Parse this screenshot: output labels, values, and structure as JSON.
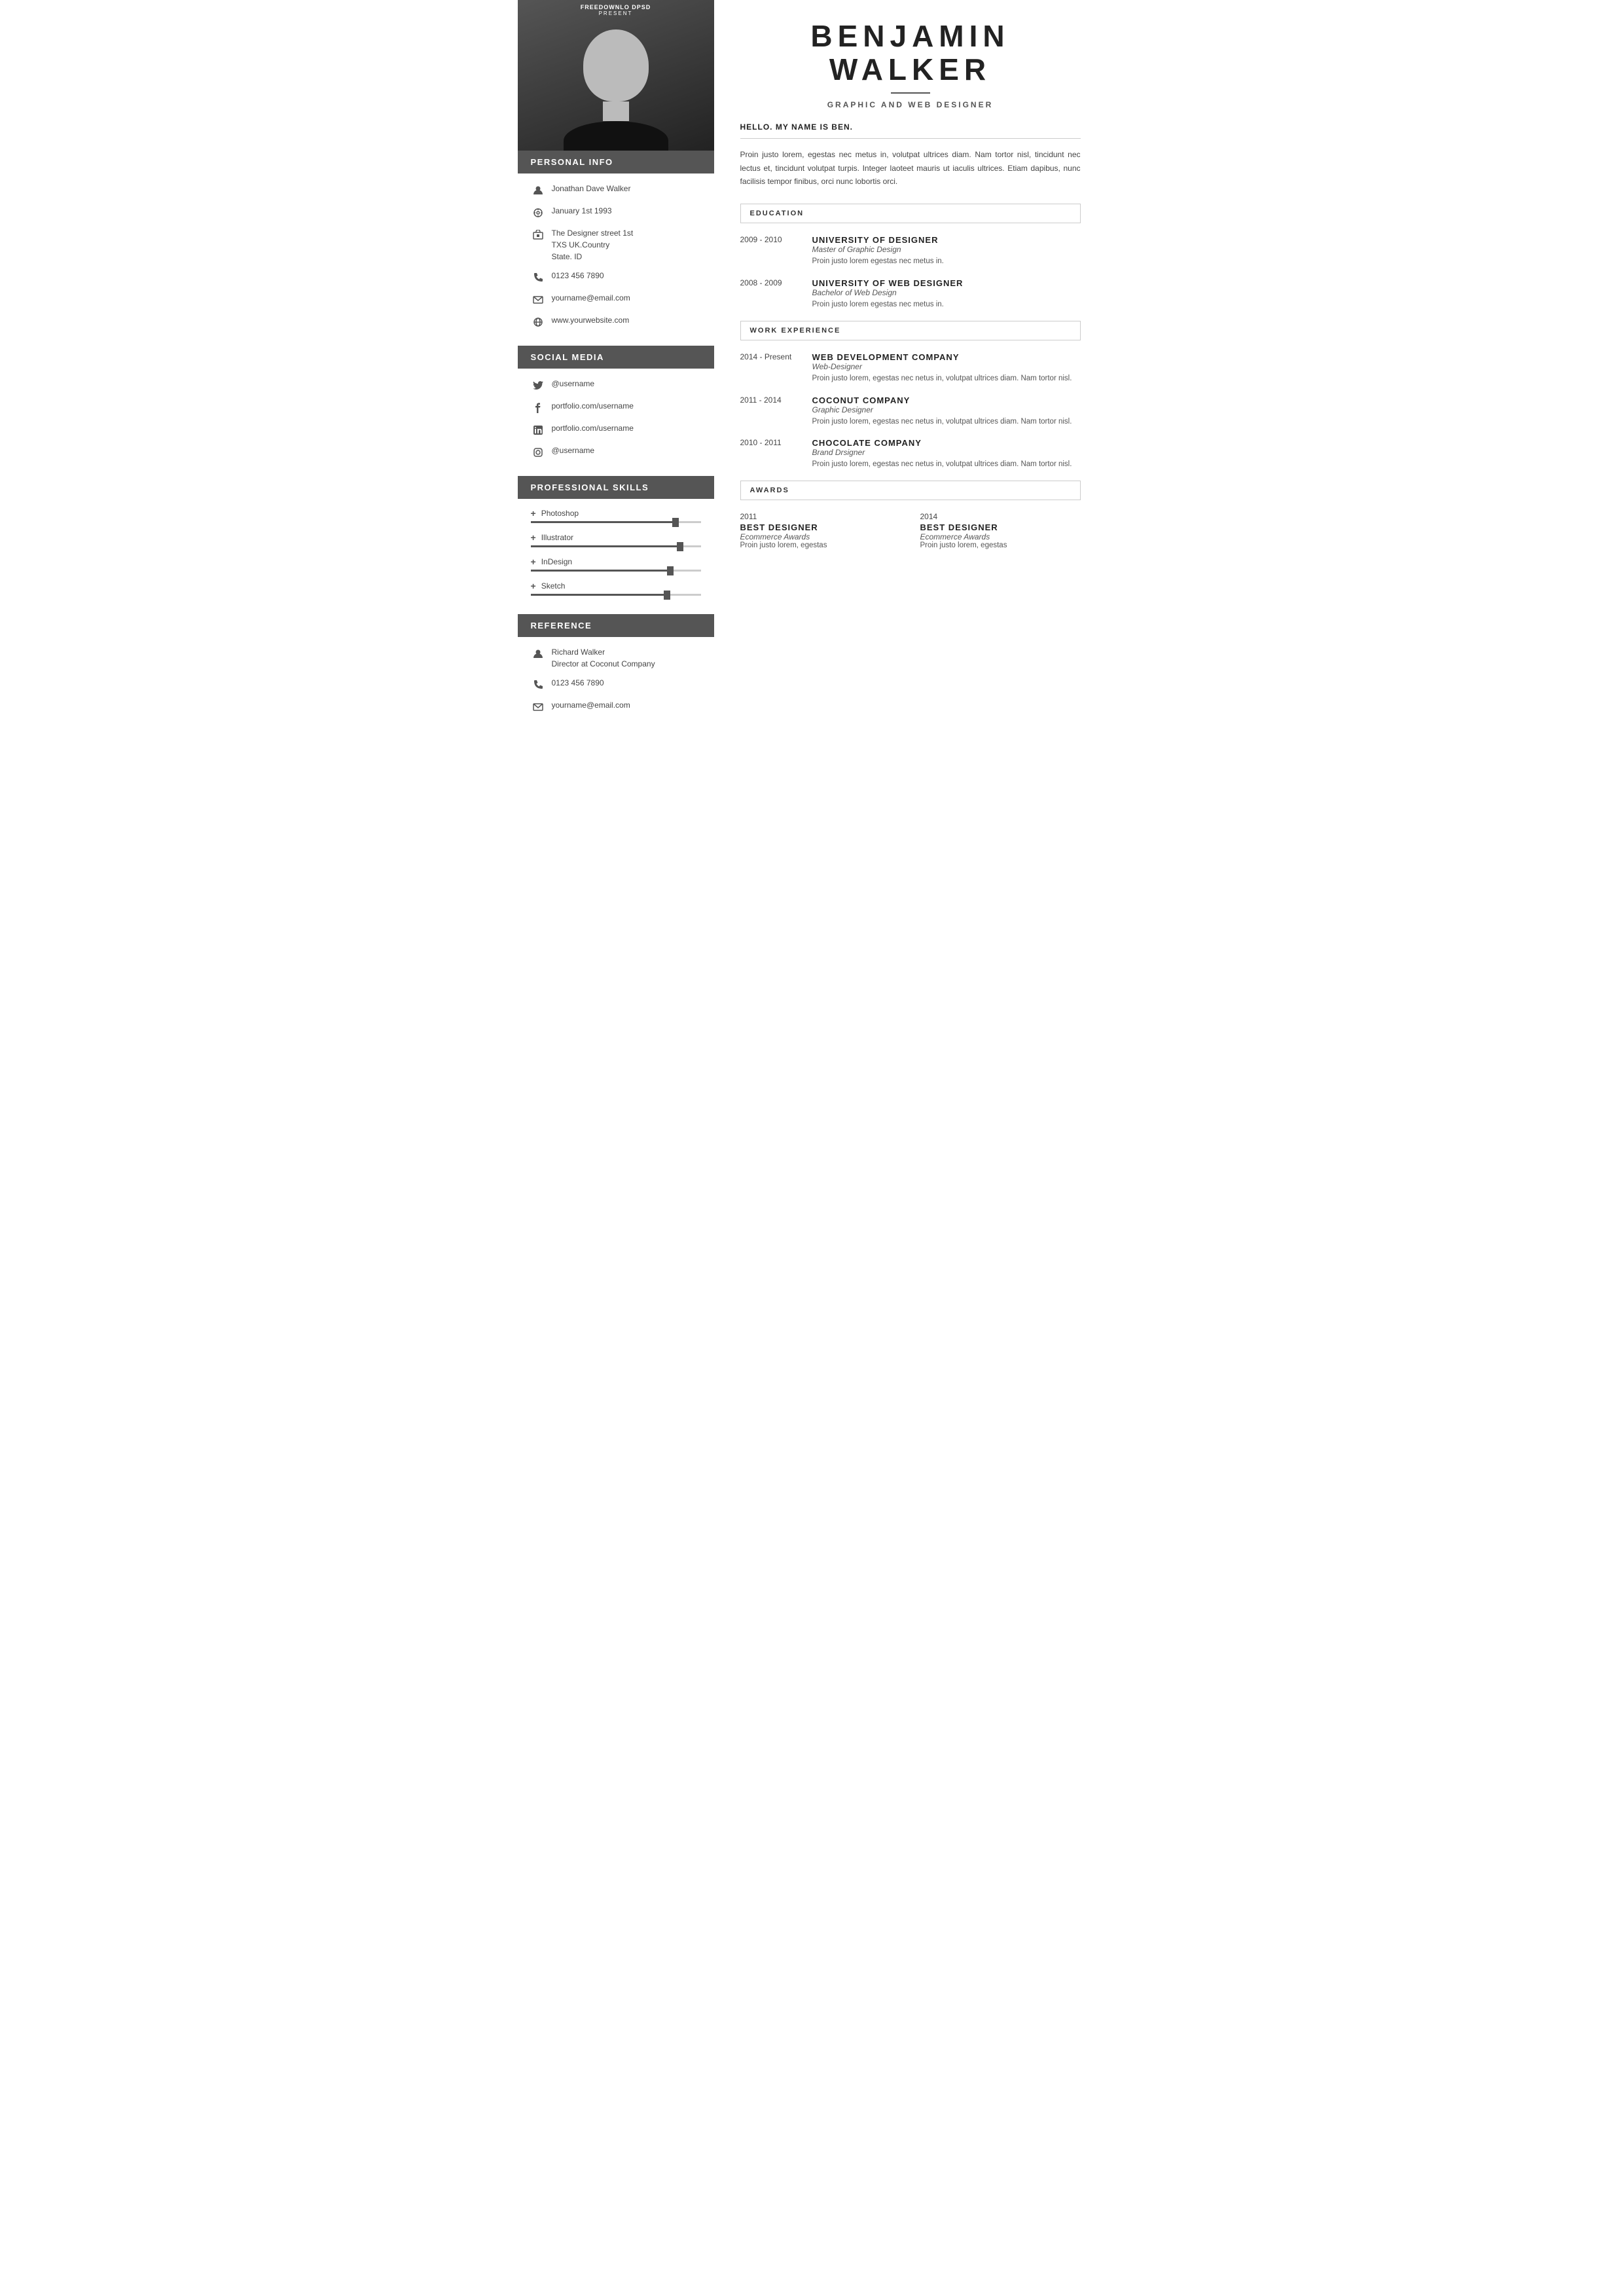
{
  "watermark": {
    "brand": "FREEDOWNLO DPSD",
    "sub": "PRESENT"
  },
  "sidebar": {
    "personal_info_heading": "PERSONAL INFO",
    "name": "Jonathan Dave Walker",
    "birthday": "January 1st 1993",
    "address": "The Designer street 1st\nTXS UK.Country\nState. ID",
    "phone": "0123 456 7890",
    "email": "yourname@email.com",
    "website": "www.yourwebsite.com",
    "social_media_heading": "SOCIAL MEDIA",
    "twitter": "@username",
    "facebook": "portfolio.com/username",
    "linkedin": "portfolio.com/username",
    "instagram": "@username",
    "skills_heading": "PROFESSIONAL  SKILLS",
    "skills": [
      {
        "name": "Photoshop",
        "percent": 85
      },
      {
        "name": "Illustrator",
        "percent": 88
      },
      {
        "name": "InDesign",
        "percent": 82
      },
      {
        "name": "Sketch",
        "percent": 80
      }
    ],
    "reference_heading": "REFERENCE",
    "ref_name": "Richard Walker",
    "ref_title": "Director at Coconut Company",
    "ref_phone": "0123 456 7890",
    "ref_email": "yourname@email.com"
  },
  "main": {
    "first_name": "BENJAMIN",
    "last_name": "WALKER",
    "job_title": "GRAPHIC AND WEB DESIGNER",
    "intro_heading": "HELLO. MY NAME IS BEN.",
    "intro_text": "Proin justo lorem, egestas nec metus in, volutpat ultrices diam. Nam tortor nisl, tincidunt nec lectus et, tincidunt volutpat turpis. Integer laoteet mauris ut iaculis ultrices. Etiam dapibus, nunc facilisis tempor finibus, orci nunc lobortis orci.",
    "education_heading": "EDUCATION",
    "education": [
      {
        "years": "2009 - 2010",
        "school": "UNIVERSITY OF DESIGNER",
        "degree": "Master of Graphic Design",
        "desc": "Proin justo lorem egestas nec metus in."
      },
      {
        "years": "2008 - 2009",
        "school": "UNIVERSITY OF WEB DESIGNER",
        "degree": "Bachelor of Web Design",
        "desc": "Proin justo lorem egestas nec metus in."
      }
    ],
    "work_heading": "WORK EXPERIENCE",
    "work": [
      {
        "years": "2014 - Present",
        "company": "WEB DEVELOPMENT COMPANY",
        "role": "Web-Designer",
        "desc": "Proin justo lorem, egestas nec netus in, volutpat ultrices diam. Nam tortor nisl."
      },
      {
        "years": "2011 - 2014",
        "company": "COCONUT COMPANY",
        "role": "Graphic Designer",
        "desc": "Proin justo lorem, egestas nec netus in, volutpat ultrices diam. Nam tortor nisl."
      },
      {
        "years": "2010 - 2011",
        "company": "CHOCOLATE  COMPANY",
        "role": "Brand Drsigner",
        "desc": "Proin justo lorem, egestas nec netus in, volutpat ultrices diam. Nam tortor nisl."
      }
    ],
    "awards_heading": "AWARDS",
    "awards": [
      {
        "year": "2011",
        "title": "BEST  DESIGNER",
        "event": "Ecommerce Awards",
        "desc": "Proin justo lorem, egestas"
      },
      {
        "year": "2014",
        "title": "BEST  DESIGNER",
        "event": "Ecommerce Awards",
        "desc": "Proin justo lorem, egestas"
      }
    ]
  }
}
